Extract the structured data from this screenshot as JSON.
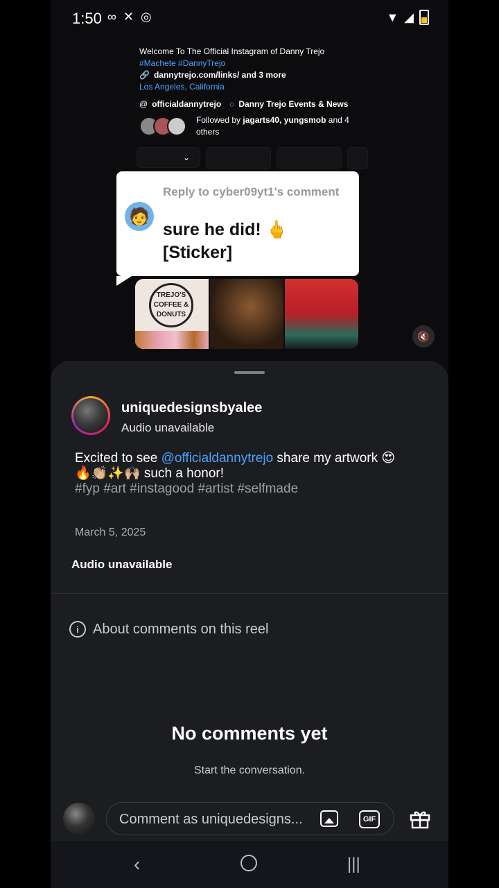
{
  "status_bar": {
    "time": "1:50"
  },
  "profile_bg": {
    "bio": "Welcome To The Official Instagram of Danny Trejo",
    "hashtags": "#Machete #DannyTrejo",
    "link": "dannytrejo.com/links/ and 3 more",
    "location": "Los Angeles, California",
    "threads_handle": "officialdannytrejo",
    "channel": "Danny Trejo Events & News",
    "followed_prefix": "Followed by",
    "followed_names": "jagarts40, yungsmob",
    "followed_suffix": "and 4 others"
  },
  "reply_bubble": {
    "reply_to": "Reply to cyber09yt1's comment",
    "comment": "sure he did! 🖕 [Sticker]"
  },
  "thumbnails": {
    "logo_text": "TREJO'S COFFEE & DONUTS"
  },
  "sheet": {
    "username": "uniquedesignsbyalee",
    "audio_status": "Audio unavailable",
    "caption_pre": "Excited to see ",
    "caption_mention": "@officialdannytrejo",
    "caption_post": " share my artwork 😍",
    "caption_line2": "🔥👏🏼✨🙌🏼 such a honor!",
    "caption_tags": "#fyp #art #instagood #artist #selfmade",
    "date": "March 5, 2025",
    "audio_label": "Audio unavailable",
    "about_comments": "About comments on this reel",
    "no_comments_title": "No comments yet",
    "no_comments_sub": "Start the conversation.",
    "comment_placeholder": "Comment as uniquedesigns...",
    "gif_label": "GIF"
  }
}
